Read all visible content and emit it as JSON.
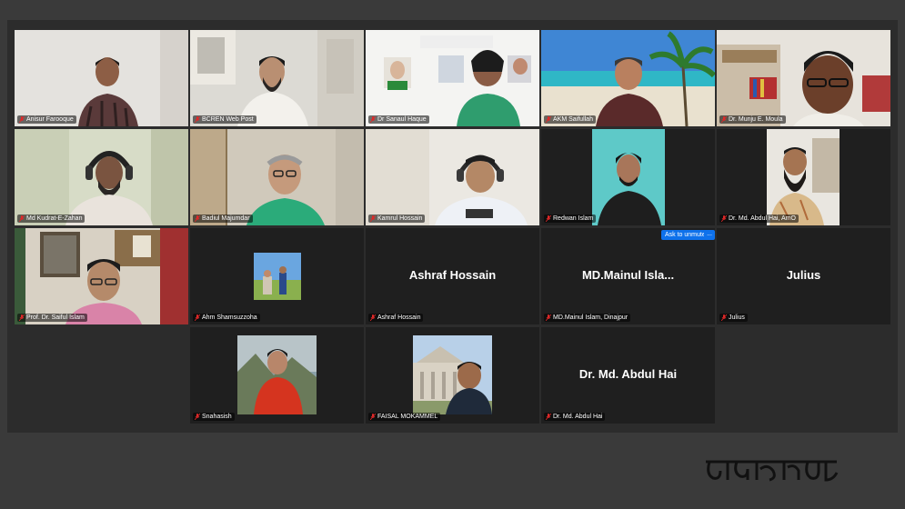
{
  "colors": {
    "background": "#3a3a3a",
    "panel": "#2c2c2c",
    "tile": "#1f1f1f",
    "active_speaker": "#23d959",
    "button": "#0e71eb",
    "muted_icon": "#e02828"
  },
  "participants": [
    {
      "name": "Anisur Farooque"
    },
    {
      "name": "BCREN Web Post"
    },
    {
      "name": "Dr Sanaul Haque"
    },
    {
      "name": "AKM Saifullah"
    },
    {
      "name": "Dr. Munju E. Moula"
    },
    {
      "name": "Md Kudrat-E-Zahan"
    },
    {
      "name": "Badiul Majumdar"
    },
    {
      "name": "Kamrul Hossain"
    },
    {
      "name": "Redwan Islam"
    },
    {
      "name": "Dr. Md. Abdul Hai, AmO"
    },
    {
      "name": "Prof. Dr. Saiful Islam"
    },
    {
      "name": "Ahm Shamsuzzoha"
    },
    {
      "name": "Ashraf Hossain",
      "display": "Ashraf Hossain"
    },
    {
      "name": "MD.Mainul Islam, Dinajpur",
      "display": "MD.Mainul  Isla..."
    },
    {
      "name": "Julius",
      "display": "Julius"
    },
    {
      "name": "Snahasish"
    },
    {
      "name": "FAISAL MOKAMMEL"
    },
    {
      "name": "Dr. Md. Abdul Hai",
      "display": "Dr. Md. Abdul Hai"
    }
  ],
  "controls": {
    "ask_to_unmute": "Ask to unmute",
    "more": "..."
  },
  "logo_text": "ভোরের কাগজ"
}
